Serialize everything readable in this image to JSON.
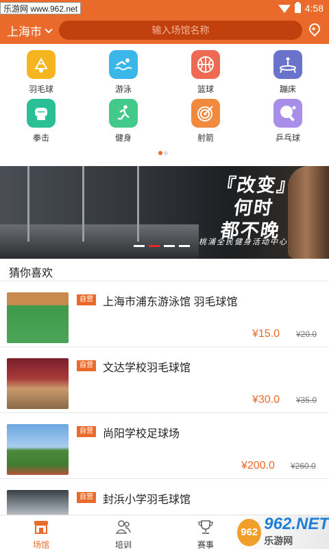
{
  "status_bar": {
    "time": "4:58",
    "watermark": "乐游网 www.962.net"
  },
  "header": {
    "city": "上海市",
    "search_placeholder": "输入场馆名称"
  },
  "categories": [
    {
      "label": "羽毛球",
      "icon": "badminton-icon",
      "color": "#f5b520"
    },
    {
      "label": "游泳",
      "icon": "swimming-icon",
      "color": "#3ab7e8"
    },
    {
      "label": "篮球",
      "icon": "basketball-icon",
      "color": "#ee6a52"
    },
    {
      "label": "蹦床",
      "icon": "trampoline-icon",
      "color": "#6873c9"
    },
    {
      "label": "拳击",
      "icon": "boxing-icon",
      "color": "#2bbf96"
    },
    {
      "label": "健身",
      "icon": "fitness-icon",
      "color": "#43c98a"
    },
    {
      "label": "射箭",
      "icon": "archery-icon",
      "color": "#f1893e"
    },
    {
      "label": "乒乓球",
      "icon": "table-tennis-icon",
      "color": "#a88ee8"
    }
  ],
  "banner": {
    "title_line1": "『改变』",
    "title_line2": "何时",
    "title_line3": "都不晚",
    "subtitle": "桃浦全民健身活动中心"
  },
  "section": {
    "title": "猜你喜欢"
  },
  "venues": [
    {
      "badge": "自营",
      "name": "上海市浦东游泳馆 羽毛球馆",
      "price": "¥15.0",
      "original_price": "¥20.0"
    },
    {
      "badge": "自营",
      "name": "文达学校羽毛球馆",
      "price": "¥30.0",
      "original_price": "¥35.0"
    },
    {
      "badge": "自营",
      "name": "尚阳学校足球场",
      "price": "¥200.0",
      "original_price": "¥260.0"
    },
    {
      "badge": "自营",
      "name": "封浜小学羽毛球馆",
      "price": "",
      "original_price": ""
    }
  ],
  "tabs": [
    {
      "label": "场馆",
      "icon": "venue-icon",
      "active": true
    },
    {
      "label": "培训",
      "icon": "training-icon",
      "active": false
    },
    {
      "label": "赛事",
      "icon": "trophy-icon",
      "active": false
    }
  ],
  "watermark_br": {
    "logo": "962",
    "text": "962.NET",
    "sub": "乐游网"
  },
  "colors": {
    "accent": "#e96a2a",
    "search_bg": "#c2400e"
  }
}
